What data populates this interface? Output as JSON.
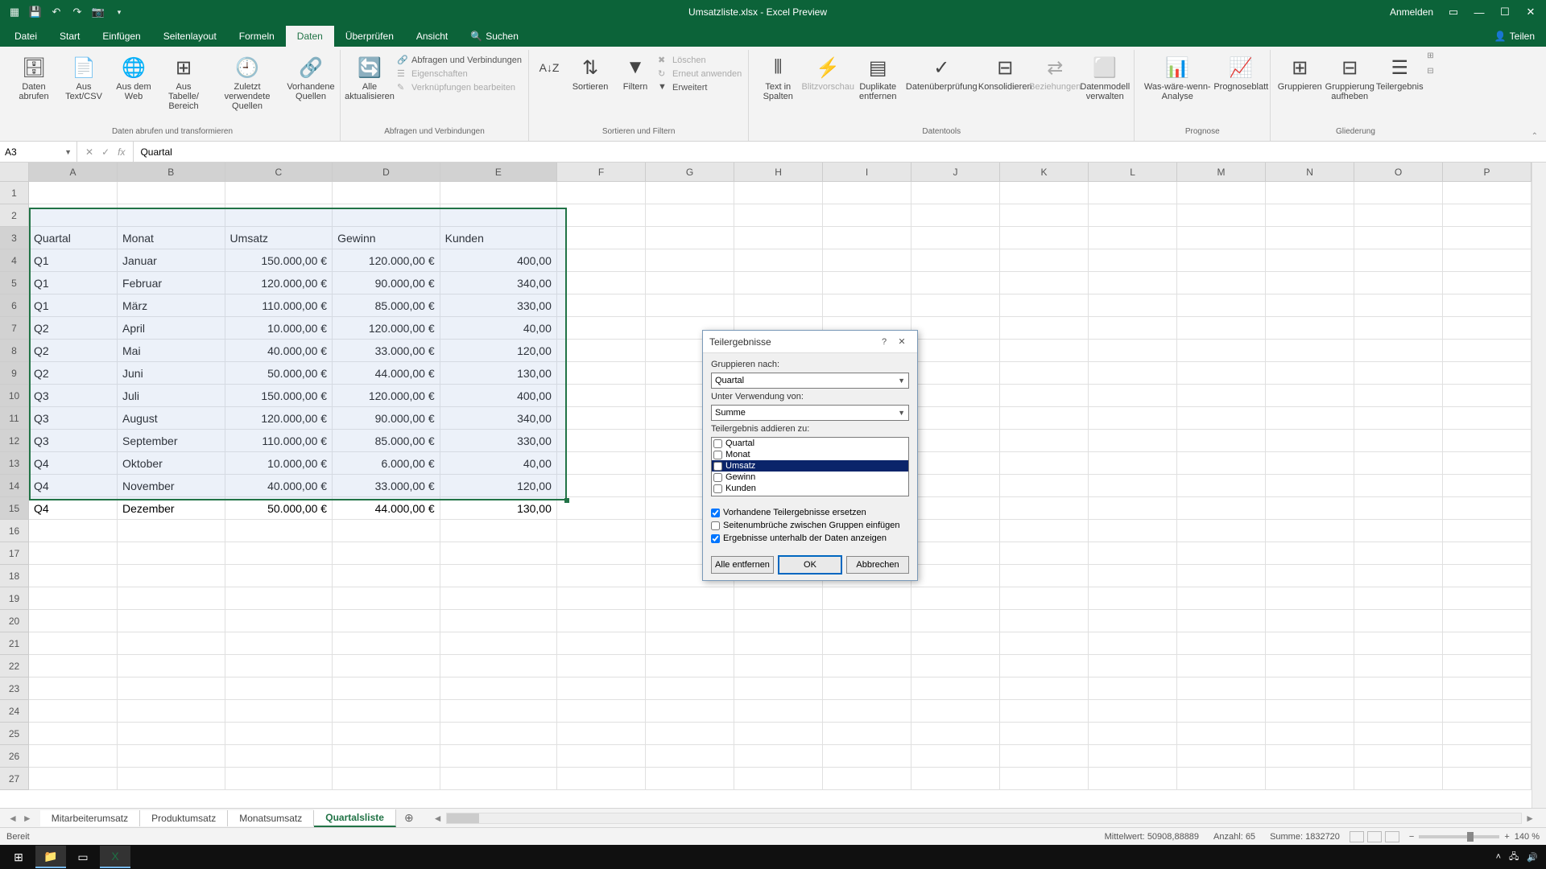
{
  "titlebar": {
    "title": "Umsatzliste.xlsx - Excel Preview",
    "signin": "Anmelden"
  },
  "tabs": {
    "datei": "Datei",
    "start": "Start",
    "einfuegen": "Einfügen",
    "seitenlayout": "Seitenlayout",
    "formeln": "Formeln",
    "daten": "Daten",
    "ueberpruefen": "Überprüfen",
    "ansicht": "Ansicht",
    "suchen": "Suchen",
    "teilen": "Teilen"
  },
  "ribbon": {
    "g1": {
      "daten_abrufen": "Daten abrufen",
      "aus_text": "Aus Text/CSV",
      "aus_web": "Aus dem Web",
      "aus_tabelle": "Aus Tabelle/ Bereich",
      "zuletzt": "Zuletzt verwendete Quellen",
      "vorhandene": "Vorhandene Quellen",
      "label": "Daten abrufen und transformieren"
    },
    "g2": {
      "alle_akt": "Alle aktualisieren",
      "abfragen": "Abfragen und Verbindungen",
      "eigenschaften": "Eigenschaften",
      "verknuepf": "Verknüpfungen bearbeiten",
      "label": "Abfragen und Verbindungen"
    },
    "g3": {
      "sortieren": "Sortieren",
      "filtern": "Filtern",
      "loeschen": "Löschen",
      "erneut": "Erneut anwenden",
      "erweitert": "Erweitert",
      "label": "Sortieren und Filtern"
    },
    "g4": {
      "text_spalten": "Text in Spalten",
      "blitz": "Blitzvorschau",
      "duplikate": "Duplikate entfernen",
      "datenueber": "Datenüberprüfung",
      "konsolidieren": "Konsolidieren",
      "beziehungen": "Beziehungen",
      "datenmodell": "Datenmodell verwalten",
      "label": "Datentools"
    },
    "g5": {
      "was_waere": "Was-wäre-wenn-Analyse",
      "prognose": "Prognoseblatt",
      "label": "Prognose"
    },
    "g6": {
      "gruppieren": "Gruppieren",
      "aufheben": "Gruppierung aufheben",
      "teilergebnis": "Teilergebnis",
      "label": "Gliederung"
    }
  },
  "namebox": "A3",
  "formula": "Quartal",
  "cols": [
    "A",
    "B",
    "C",
    "D",
    "E",
    "F",
    "G",
    "H",
    "I",
    "J",
    "K",
    "L",
    "M",
    "N",
    "O",
    "P"
  ],
  "rows": [
    "1",
    "2",
    "3",
    "4",
    "5",
    "6",
    "7",
    "8",
    "9",
    "10",
    "11",
    "12",
    "13",
    "14",
    "15",
    "16",
    "17",
    "18",
    "19",
    "20",
    "21",
    "22",
    "23",
    "24",
    "25",
    "26",
    "27"
  ],
  "headers": {
    "A": "Quartal",
    "B": "Monat",
    "C": "Umsatz",
    "D": "Gewinn",
    "E": "Kunden"
  },
  "data": [
    {
      "q": "Q1",
      "m": "Januar",
      "u": "150.000,00 €",
      "g": "120.000,00 €",
      "k": "400,00"
    },
    {
      "q": "Q1",
      "m": "Februar",
      "u": "120.000,00 €",
      "g": "90.000,00 €",
      "k": "340,00"
    },
    {
      "q": "Q1",
      "m": "März",
      "u": "110.000,00 €",
      "g": "85.000,00 €",
      "k": "330,00"
    },
    {
      "q": "Q2",
      "m": "April",
      "u": "10.000,00 €",
      "g": "120.000,00 €",
      "k": "40,00"
    },
    {
      "q": "Q2",
      "m": "Mai",
      "u": "40.000,00 €",
      "g": "33.000,00 €",
      "k": "120,00"
    },
    {
      "q": "Q2",
      "m": "Juni",
      "u": "50.000,00 €",
      "g": "44.000,00 €",
      "k": "130,00"
    },
    {
      "q": "Q3",
      "m": "Juli",
      "u": "150.000,00 €",
      "g": "120.000,00 €",
      "k": "400,00"
    },
    {
      "q": "Q3",
      "m": "August",
      "u": "120.000,00 €",
      "g": "90.000,00 €",
      "k": "340,00"
    },
    {
      "q": "Q3",
      "m": "September",
      "u": "110.000,00 €",
      "g": "85.000,00 €",
      "k": "330,00"
    },
    {
      "q": "Q4",
      "m": "Oktober",
      "u": "10.000,00 €",
      "g": "6.000,00 €",
      "k": "40,00"
    },
    {
      "q": "Q4",
      "m": "November",
      "u": "40.000,00 €",
      "g": "33.000,00 €",
      "k": "120,00"
    },
    {
      "q": "Q4",
      "m": "Dezember",
      "u": "50.000,00 €",
      "g": "44.000,00 €",
      "k": "130,00"
    }
  ],
  "sheets": {
    "s1": "Mitarbeiterumsatz",
    "s2": "Produktumsatz",
    "s3": "Monatsumsatz",
    "s4": "Quartalsliste"
  },
  "status": {
    "ready": "Bereit",
    "avg_l": "Mittelwert:",
    "avg_v": "50908,88889",
    "cnt_l": "Anzahl:",
    "cnt_v": "65",
    "sum_l": "Summe:",
    "sum_v": "1832720",
    "zoom": "140 %"
  },
  "dialog": {
    "title": "Teilergebnisse",
    "gruppieren": "Gruppieren nach:",
    "gruppieren_v": "Quartal",
    "verwendung": "Unter Verwendung von:",
    "verwendung_v": "Summe",
    "addieren": "Teilergebnis addieren zu:",
    "items": {
      "quartal": "Quartal",
      "monat": "Monat",
      "umsatz": "Umsatz",
      "gewinn": "Gewinn",
      "kunden": "Kunden"
    },
    "chk1": "Vorhandene Teilergebnisse ersetzen",
    "chk2": "Seitenumbrüche zwischen Gruppen einfügen",
    "chk3": "Ergebnisse unterhalb der Daten anzeigen",
    "btn_remove": "Alle entfernen",
    "btn_ok": "OK",
    "btn_cancel": "Abbrechen"
  }
}
